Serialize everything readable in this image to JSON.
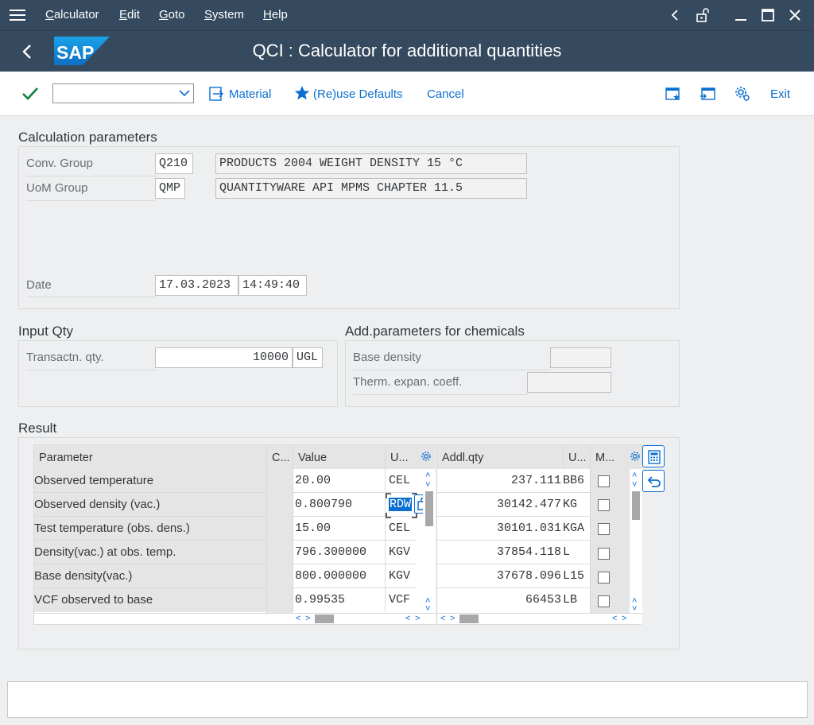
{
  "menu": {
    "items": [
      "Calculator",
      "Edit",
      "Goto",
      "System",
      "Help"
    ]
  },
  "title": {
    "logo_text": "SAP",
    "text": "QCI : Calculator for additional quantities"
  },
  "toolbar": {
    "material": "Material",
    "reuse": "(Re)use Defaults",
    "cancel": "Cancel",
    "exit": "Exit",
    "command_value": ""
  },
  "calc": {
    "title": "Calculation parameters",
    "conv_group_label": "Conv. Group",
    "conv_group_value": "Q210",
    "conv_group_desc": "PRODUCTS 2004 WEIGHT DENSITY 15 °C",
    "uom_group_label": "UoM Group",
    "uom_group_value": "QMP",
    "uom_group_desc": "QUANTITYWARE API MPMS CHAPTER 11.5",
    "date_label": "Date",
    "date_value": "17.03.2023",
    "time_value": "14:49:40"
  },
  "input": {
    "title": "Input Qty",
    "qty_label": "Transactn. qty.",
    "qty_value": "10000",
    "qty_unit": "UGL"
  },
  "chem": {
    "title": "Add.parameters for chemicals",
    "base_density_label": "Base density",
    "therm_label": "Therm. expan. coeff."
  },
  "result": {
    "title": "Result",
    "headers": {
      "parameter": "Parameter",
      "c": "C...",
      "value": "Value",
      "u": "U...",
      "addl": "Addl.qty",
      "u2": "U...",
      "m": "M..."
    },
    "rows": [
      {
        "param": "Observed temperature",
        "value": "20.00",
        "unit": "CEL",
        "qty": "237.111",
        "qunit": "BB6"
      },
      {
        "param": "Observed density (vac.)",
        "value": "0.800790",
        "unit": "RDW",
        "qty": "30142.477",
        "qunit": "KG"
      },
      {
        "param": "Test temperature (obs. dens.)",
        "value": "15.00",
        "unit": "CEL",
        "qty": "30101.031",
        "qunit": "KGA"
      },
      {
        "param": "Density(vac.) at obs. temp.",
        "value": "796.300000",
        "unit": "KGV",
        "qty": "37854.118",
        "qunit": "L"
      },
      {
        "param": "Base density(vac.)",
        "value": "800.000000",
        "unit": "KGV",
        "qty": "37678.096",
        "qunit": "L15"
      },
      {
        "param": "VCF observed to base",
        "value": "0.99535",
        "unit": "VCF",
        "qty": "66453",
        "qunit": "LB"
      }
    ]
  },
  "colors": {
    "shell": "#354a5f",
    "accent": "#0a6ed1",
    "check": "#107e3e"
  }
}
